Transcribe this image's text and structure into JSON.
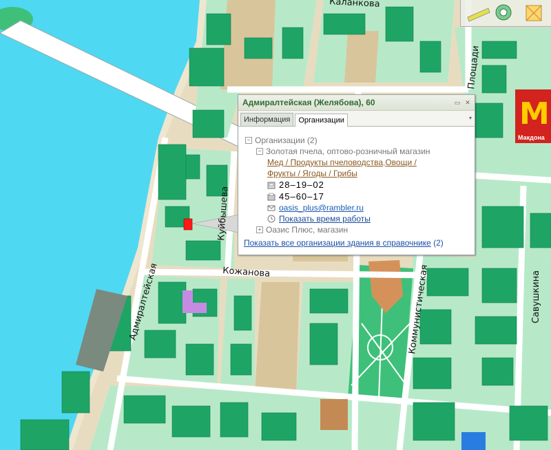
{
  "colors": {
    "water": "#4fd8f2",
    "sand": "#e8dcc0",
    "block": "#d9c59b",
    "green": "#b7e9c9",
    "building": "#1ea566",
    "park": "#3fc07a",
    "road": "#ffffff",
    "highlight": "#ff1a1a",
    "purple": "#c58be3",
    "orange": "#c48a55",
    "blue": "#2a7de0"
  },
  "popup": {
    "title": "Адмиралтейская (Желябова), 60",
    "tabs": [
      "Информация",
      "Организации"
    ],
    "active_tab": 1,
    "tree": {
      "root": "Организации (2)",
      "org1": {
        "name": "Золотая пчела, оптово-розничный магазин",
        "categories_line1_a": "Мед / Продукты пчеловодства",
        "categories_line1_sep": ", ",
        "categories_line1_b": "Овощи /",
        "categories_line2": "Фрукты / Ягоды / Грибы",
        "phone1": "28–19–02",
        "phone2": "45–60–17",
        "email": "oasis_plus@rambler.ru",
        "hours_link": "Показать время работы"
      },
      "org2": "Оазис Плюс, магазин"
    },
    "footer_link": "Показать все организации здания в справочнике",
    "footer_count": "(2)"
  },
  "streets": {
    "admiralteyskaya": "Адмиралтейская",
    "kuybysheva": "Куйбышева",
    "kozhanova": "Кожанова",
    "kommunisticheskaya": "Коммунистическая",
    "savushkina": "Савушкина",
    "top_partial": "Каланкова",
    "ploshchadi": "Площади"
  },
  "poi": {
    "mcdonalds_text": "Макдона"
  },
  "icons": [
    "ruler-icon",
    "zoom-icon",
    "layers-icon",
    "phone-icon",
    "fax-icon",
    "email-icon",
    "clock-icon"
  ]
}
